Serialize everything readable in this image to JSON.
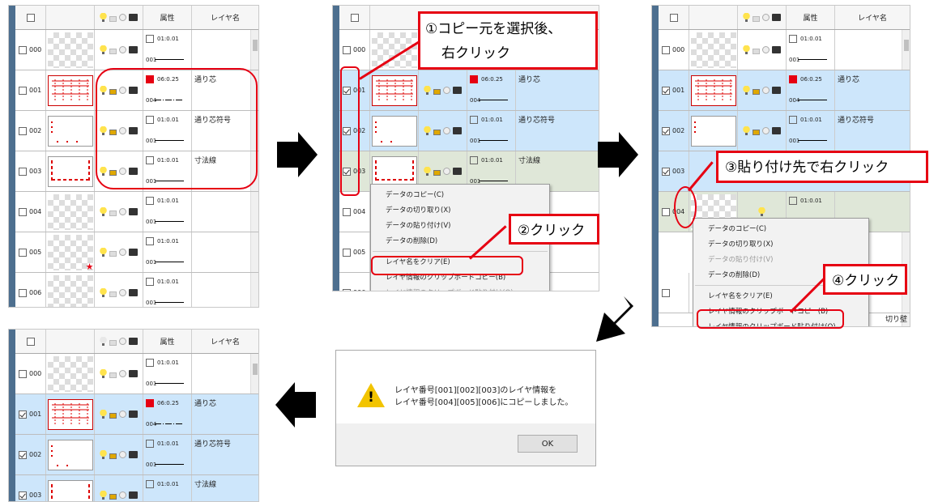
{
  "columns": {
    "attr": "属性",
    "layer_name": "レイヤ名"
  },
  "rows": {
    "r000": {
      "num": "000",
      "attr_val": "01:0.01",
      "attr_code": "001"
    },
    "r001": {
      "num": "001",
      "attr_val": "06:0.25",
      "attr_code": "004",
      "name": "通り芯"
    },
    "r002": {
      "num": "002",
      "attr_val": "01:0.01",
      "attr_code": "001",
      "name": "通り芯符号"
    },
    "r003": {
      "num": "003",
      "attr_val": "01:0.01",
      "attr_code": "001",
      "name": "寸法線"
    },
    "r004": {
      "num": "004",
      "attr_val": "01:0.01",
      "attr_code": "001"
    },
    "r005": {
      "num": "005",
      "attr_val": "01:0.01",
      "attr_code": "001"
    },
    "r006": {
      "num": "006",
      "attr_val": "01:0.01",
      "attr_code": "001"
    }
  },
  "partial_wall_name": "切り壁",
  "menu": {
    "copy": "データのコピー(C)",
    "cut": "データの切り取り(X)",
    "paste": "データの貼り付け(V)",
    "delete": "データの削除(D)",
    "clear_name": "レイヤ名をクリア(E)",
    "clip_copy": "レイヤ情報のクリップボードコピー(B)",
    "clip_paste": "レイヤ情報のクリップボード貼り付け(O)"
  },
  "callouts": {
    "step1_line1": "①コピー元を選択後、",
    "step1_line2": "右クリック",
    "step2": "②クリック",
    "step3": "③貼り付け先で右クリック",
    "step4": "④クリック"
  },
  "dialog": {
    "line1": "レイヤ番号[001][002][003]のレイヤ情報を",
    "line2": "レイヤ番号[004][005][006]にコピーしました。",
    "ok": "OK"
  },
  "colors": {
    "accent_red": "#e60012",
    "selection_blue": "#cde6fb",
    "strip": "#4d6f8f"
  }
}
